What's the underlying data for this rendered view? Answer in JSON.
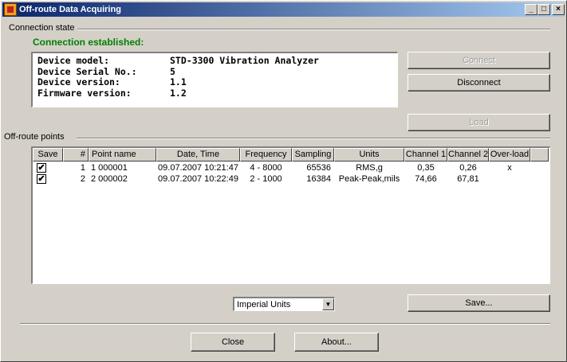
{
  "window": {
    "title": "Off-route Data Acquiring",
    "minimize_glyph": "_",
    "maximize_glyph": "□",
    "close_glyph": "×"
  },
  "connection": {
    "group_label": "Connection state",
    "status_text": "Connection established:",
    "status_color": "#008000",
    "info": [
      {
        "key": "Device model:",
        "value": "STD-3300 Vibration Analyzer"
      },
      {
        "key": "Device Serial No.:",
        "value": "5"
      },
      {
        "key": "Device version:",
        "value": "1.1"
      },
      {
        "key": "Firmware version:",
        "value": "1.2"
      }
    ],
    "buttons": {
      "connect": "Connect",
      "disconnect": "Disconnect",
      "load": "Load"
    }
  },
  "offroute": {
    "group_label": "Off-route points",
    "columns": [
      "Save",
      "#",
      "Point name",
      "Date, Time",
      "Frequency",
      "Sampling",
      "Units",
      "Channel 1",
      "Channel 2",
      "Over-load"
    ],
    "rows": [
      {
        "save": "✔",
        "num": "1",
        "name": "1 000001",
        "datetime": "09.07.2007 10:21:47",
        "frequency": "4 - 8000",
        "sampling": "65536",
        "units": "RMS,g",
        "ch1": "0,35",
        "ch2": "0,26",
        "overload": "x"
      },
      {
        "save": "✔",
        "num": "2",
        "name": "2 000002",
        "datetime": "09.07.2007 10:22:49",
        "frequency": "2 - 1000",
        "sampling": "16384",
        "units": "Peak-Peak,mils",
        "ch1": "74,66",
        "ch2": "67,81",
        "overload": ""
      }
    ]
  },
  "units_select": {
    "value": "Imperial Units"
  },
  "footer": {
    "save": "Save...",
    "close": "Close",
    "about": "About..."
  }
}
